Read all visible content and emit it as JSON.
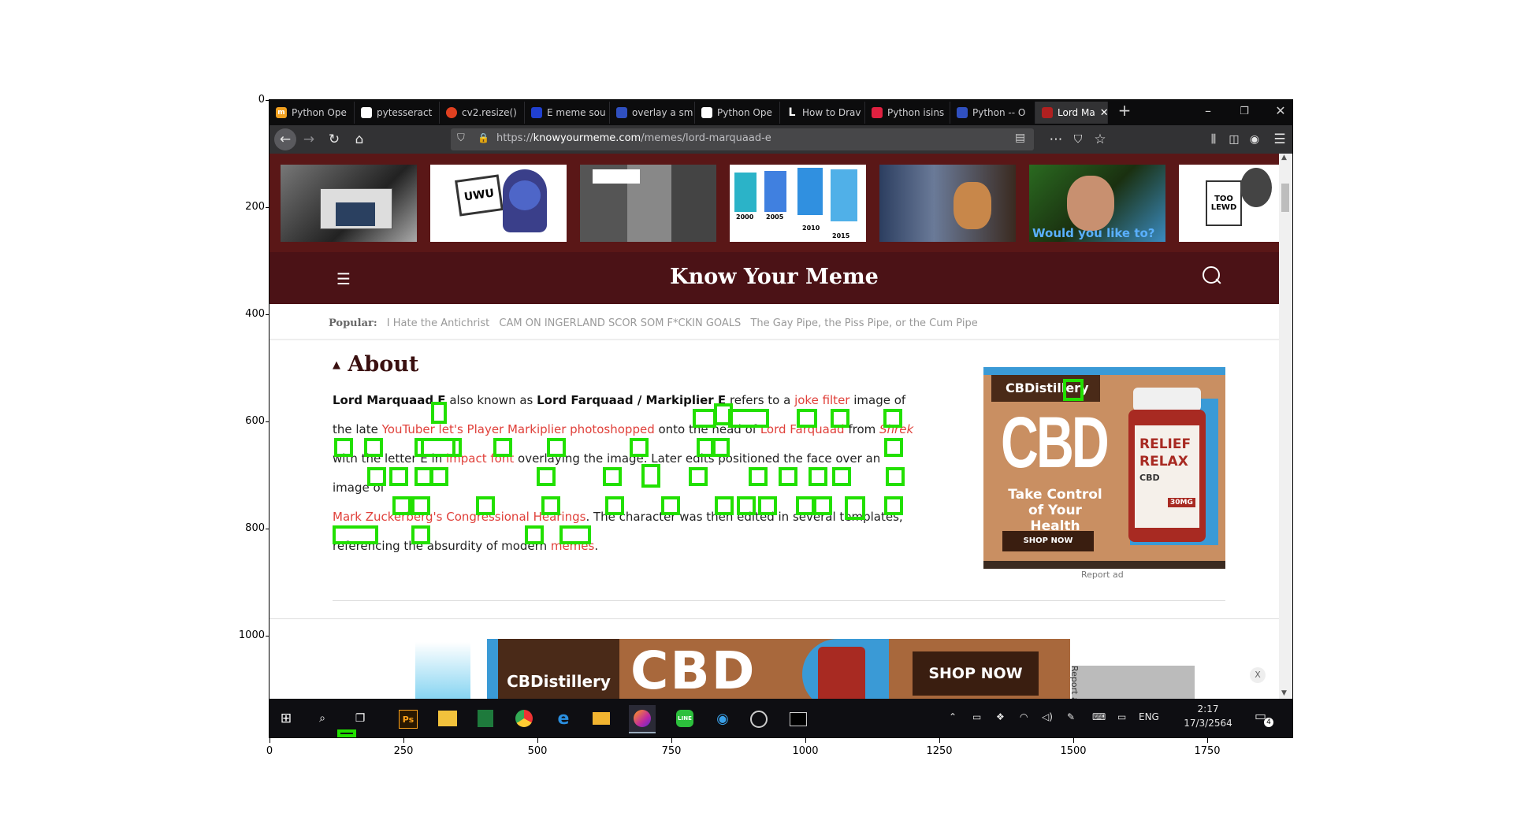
{
  "axes": {
    "y_ticks": [
      "0",
      "200",
      "400",
      "600",
      "800",
      "1000"
    ],
    "x_ticks": [
      "0",
      "250",
      "500",
      "750",
      "1000",
      "1250",
      "1500",
      "1750"
    ]
  },
  "browser": {
    "tabs": [
      {
        "label": "Python Ope",
        "fav_color": "#f0a020",
        "fav_glyph": "m"
      },
      {
        "label": "pytesseract",
        "fav_color": "#ffffff",
        "fav_glyph": ""
      },
      {
        "label": "cv2.resize()",
        "fav_color": "#e04020",
        "fav_glyph": ""
      },
      {
        "label": "E meme sou",
        "fav_color": "#2040d0",
        "fav_glyph": ""
      },
      {
        "label": "overlay a sm",
        "fav_color": "#3050c0",
        "fav_glyph": ""
      },
      {
        "label": "Python Ope",
        "fav_color": "#ffffff",
        "fav_glyph": ""
      },
      {
        "label": "How to Drav",
        "fav_color": "#0c0c0d",
        "fav_glyph": "L"
      },
      {
        "label": "Python isins",
        "fav_color": "#e02040",
        "fav_glyph": ""
      },
      {
        "label": "Python -- O",
        "fav_color": "#3050c0",
        "fav_glyph": ""
      },
      {
        "label": "Lord Ma",
        "fav_color": "#b02020",
        "fav_glyph": ""
      }
    ],
    "url_prefix": "https://",
    "url_domain": "knowyourmeme.com",
    "url_path": "/memes/lord-marquaad-e"
  },
  "site": {
    "logo": "Know Your Meme",
    "popular_label": "Popular:",
    "popular_items": [
      "I Hate the Antichrist",
      "CAM ON INGERLAND SCOR SOM F*CKIN GOALS",
      "The Gay Pipe, the Piss Pipe, or the Cum Pipe"
    ],
    "thumb_caption": "Would you like to?",
    "thumb_sign_uwu": "UWU",
    "thumb_sign_lewd": "TOO LEWD",
    "thumb_years": [
      "2000",
      "2005",
      "2010",
      "2015"
    ],
    "about_heading": "About",
    "about_lines": [
      "<b>Lord Marquaad E</b> also known as <b>Lord Farquaad / Markiplier E</b> refers to a <span class='red'>joke filter</span> image of",
      "the late <span class='red'>YouTuber let's Player Markiplier photoshopped</span> onto the head of <span class='red'>Lord Farquaad</span> from <span class='red'><i>Shrek</i></span>",
      "with the letter E in <span class='red'>impact font</span> overlaying the image. Later edits positioned the face over an image of",
      "<span class='red'>Mark Zuckerberg's Congressional Hearings</span>. The character was then edited in several templates,",
      "referencing the absurdity of modern <span class='red'>memes</span>."
    ],
    "ad_brand": "CBDistillery",
    "ad_big": "CBD",
    "ad_tagline": "Take Control of Your Health",
    "ad_cta": "SHOP NOW",
    "ad_bottle_1": "RELIEF",
    "ad_bottle_2": "RELAX",
    "ad_bottle_3": "CBD",
    "ad_bottle_4": "30MG",
    "report_ad": "Report ad",
    "bottom_ad_brand": "CBDistillery",
    "bottom_ad_big": "CBD",
    "bottom_ad_cta": "SHOP NOW",
    "bottom_close": "X"
  },
  "taskbar": {
    "lang": "ENG",
    "time": "2:17",
    "date": "17/3/2564",
    "notif_count": "4"
  }
}
